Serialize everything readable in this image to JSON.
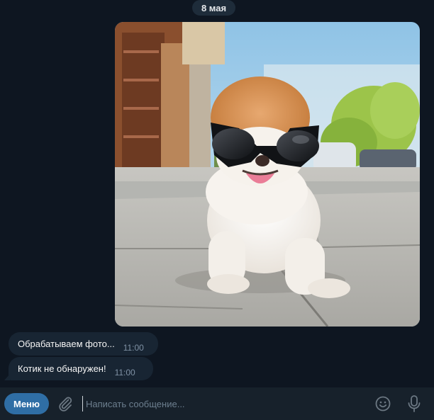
{
  "chat": {
    "date": "8 мая",
    "photo": {
      "subject": "dog-in-sunglasses-photo"
    },
    "messages": [
      {
        "text": "Обрабатываем фото...",
        "time": "11:00"
      },
      {
        "text": "Котик не обнаружен!",
        "time": "11:00"
      }
    ]
  },
  "composer": {
    "menu_label": "Меню",
    "placeholder": "Написать сообщение...",
    "icons": [
      "paperclip-icon",
      "emoji-icon",
      "microphone-icon"
    ]
  },
  "colors": {
    "background": "#0e1621",
    "bubble": "#182533",
    "composer": "#17212b",
    "accent": "#2f6ea5",
    "time": "#7f91a4"
  }
}
